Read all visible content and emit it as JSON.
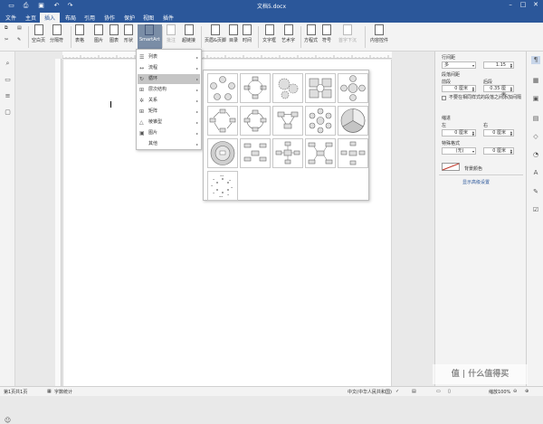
{
  "window": {
    "title": "文档5.docx",
    "quick_access": [
      "save-icon",
      "print-icon",
      "print-preview-icon",
      "undo-icon",
      "redo-icon"
    ],
    "controls": {
      "minimize": "–",
      "restore": "□",
      "close": "✕"
    }
  },
  "menubar": {
    "tabs": [
      "文件",
      "主页",
      "插入",
      "布局",
      "引用",
      "协作",
      "保护",
      "视图",
      "插件"
    ],
    "active": "插入"
  },
  "ribbon": {
    "clipboard": [
      "copy-icon",
      "paste-icon",
      "cut-icon",
      "format-painter-icon"
    ],
    "buttons": [
      "空白页",
      "分隔符",
      "表格",
      "图片",
      "图表",
      "形状",
      "SmartArt",
      "批注",
      "超链接",
      "页眉&页脚",
      "目录",
      "时间",
      "文字框",
      "艺术字",
      "方程式",
      "符号",
      "首字下沉",
      "内容控件"
    ]
  },
  "sidebar_left": [
    "search-icon",
    "comments-icon",
    "headings-icon",
    "chat-icon",
    "feedback-icon"
  ],
  "smartart_menu": {
    "items": [
      {
        "label": "列表",
        "icon": "list-icon"
      },
      {
        "label": "流程",
        "icon": "process-icon"
      },
      {
        "label": "循环",
        "icon": "cycle-icon"
      },
      {
        "label": "层次结构",
        "icon": "hierarchy-icon"
      },
      {
        "label": "关系",
        "icon": "relationship-icon"
      },
      {
        "label": "矩阵",
        "icon": "matrix-icon"
      },
      {
        "label": "棱锥型",
        "icon": "pyramid-icon"
      },
      {
        "label": "图片",
        "icon": "picture-icon"
      },
      {
        "label": "其他",
        "icon": ""
      }
    ],
    "hovered": "循环"
  },
  "cycle_gallery": {
    "layouts": [
      "basic-cycle",
      "text-cycle",
      "gear",
      "cycle-matrix",
      "radial-cycle",
      "basic-cycle-arrows",
      "continuous-cycle",
      "segmented-cycle",
      "block-cycle",
      "multidirectional-cycle",
      "nondirectional-cycle",
      "circular-venn",
      "block-radial",
      "diverging-radial",
      "basic-radial",
      "radial-cluster",
      "hexagon-radial",
      "circle-arrow-process",
      "cycle-ring"
    ]
  },
  "paragraph_panel": {
    "line_spacing_label": "行间距",
    "line_spacing_mode": "多",
    "line_spacing_value": "1.15",
    "paragraph_spacing_label": "段落间距",
    "before_label": "前段",
    "after_label": "后段",
    "before_value": "0 厘米",
    "after_value": "0.35 厘米",
    "no_spacing_checkbox": "不要在相同样式的段落之间添加间隔",
    "indent_label": "缩进",
    "left_label": "左",
    "right_label": "右",
    "left_value": "0 厘米",
    "right_value": "0 厘米",
    "special_label": "特殊格式",
    "special_value": "(无)",
    "special_amount": "0 厘米",
    "background_label": "背景颜色",
    "advanced_link": "显示高级设置"
  },
  "right_iconbar": [
    "paragraph-settings-icon",
    "table-settings-icon",
    "image-settings-icon",
    "header-settings-icon",
    "shape-settings-icon",
    "chart-settings-icon",
    "textart-settings-icon",
    "signature-settings-icon",
    "form-settings-icon"
  ],
  "statusbar": {
    "page_info": "第1页共1页",
    "word_count": "字数统计",
    "language": "中文(中华人民共和国)",
    "zoom": "缩放100%"
  },
  "watermark": "值 | 什么值得买",
  "colors": {
    "brand": "#2b579a",
    "menu_hover": "#c5c5c5",
    "thumb_fill": "#dedede",
    "thumb_stroke": "#6a6a6a",
    "accent_red": "#c0392b"
  }
}
